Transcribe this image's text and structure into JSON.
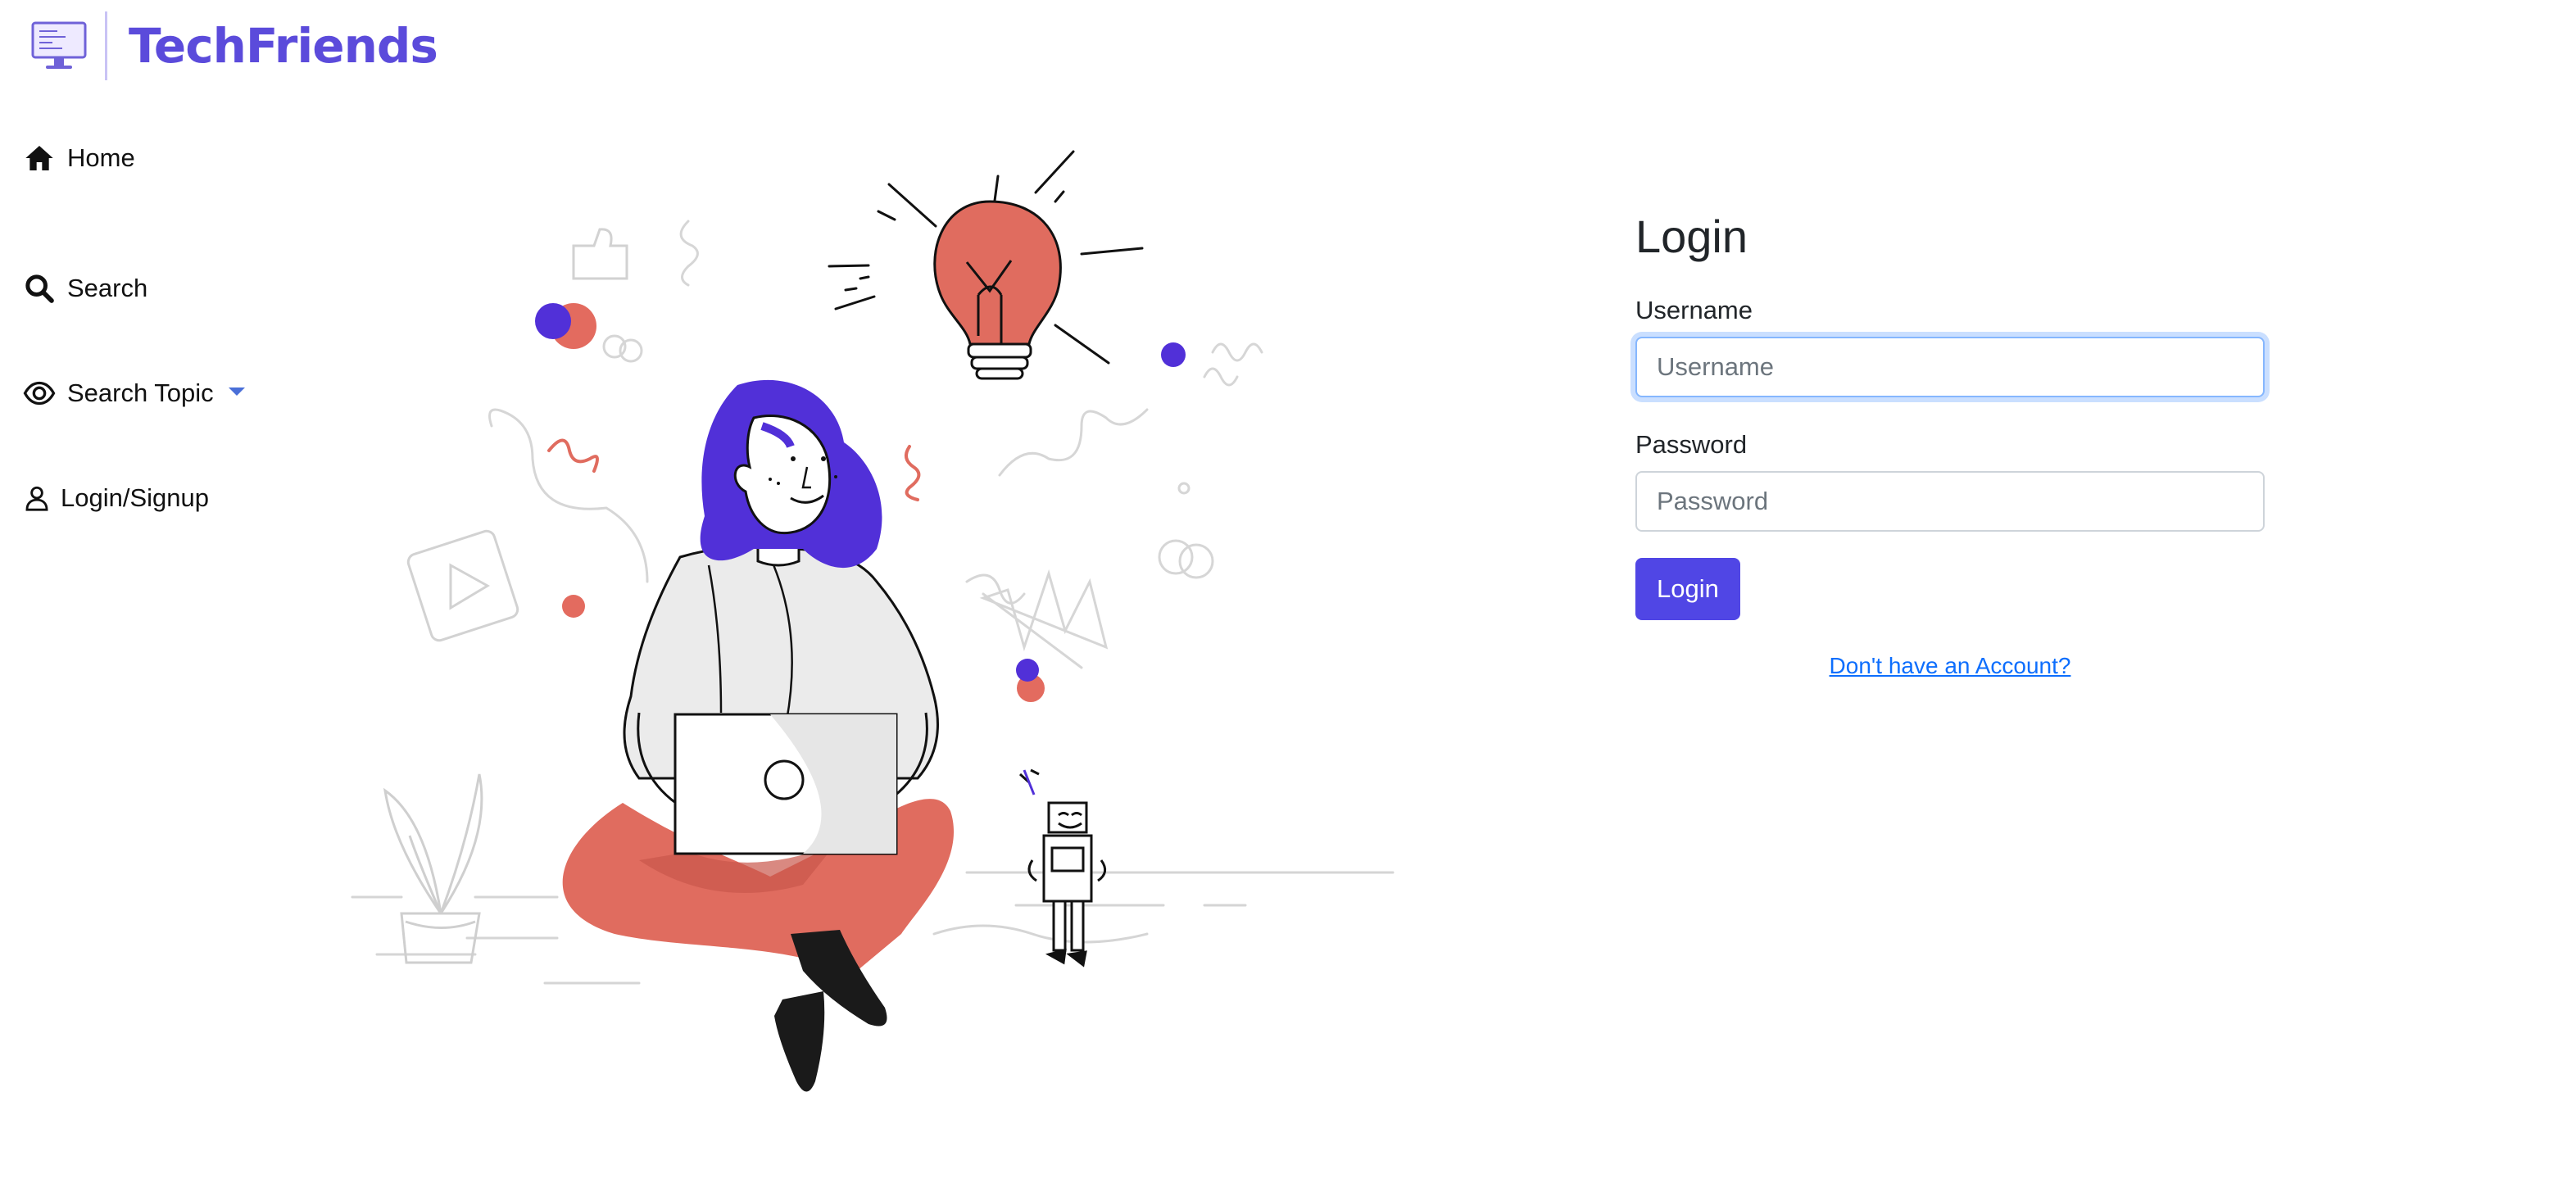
{
  "brand": {
    "name": "TechFriends",
    "color": "#5b4bdb"
  },
  "sidebar": {
    "items": [
      {
        "label": "Home",
        "icon": "home-icon"
      },
      {
        "label": "Search",
        "icon": "search-icon"
      },
      {
        "label": "Search Topic",
        "icon": "eye-icon",
        "has_dropdown": true
      },
      {
        "label": "Login/Signup",
        "icon": "user-icon"
      }
    ]
  },
  "login": {
    "title": "Login",
    "username_label": "Username",
    "username_placeholder": "Username",
    "username_value": "",
    "password_label": "Password",
    "password_placeholder": "Password",
    "password_value": "",
    "submit_label": "Login",
    "signup_link": "Don't have an Account?",
    "accent_color": "#5046e5"
  }
}
